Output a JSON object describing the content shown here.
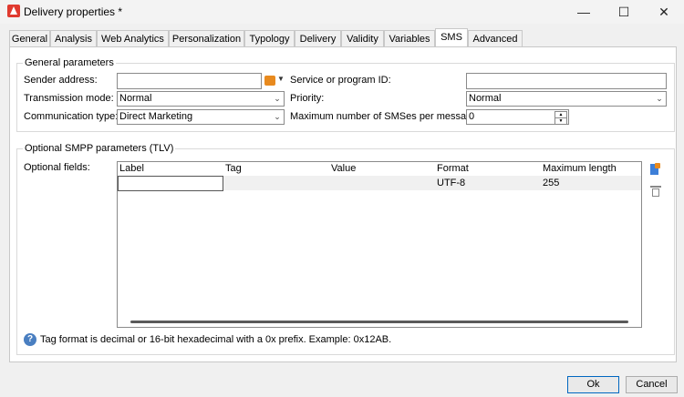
{
  "window": {
    "title": "Delivery properties *"
  },
  "tabs": [
    "General",
    "Analysis",
    "Web Analytics",
    "Personalization",
    "Typology",
    "Delivery",
    "Validity",
    "Variables",
    "SMS",
    "Advanced"
  ],
  "active_tab": "SMS",
  "general_parameters": {
    "title": "General parameters",
    "sender_address_label": "Sender address:",
    "sender_address_value": "",
    "service_id_label": "Service or program ID:",
    "service_id_value": "",
    "transmission_mode_label": "Transmission mode:",
    "transmission_mode_value": "Normal",
    "priority_label": "Priority:",
    "priority_value": "Normal",
    "communication_type_label": "Communication type:",
    "communication_type_value": "Direct Marketing",
    "max_sms_label": "Maximum number of SMSes per message:",
    "max_sms_value": "0"
  },
  "smpp": {
    "title": "Optional SMPP parameters (TLV)",
    "optional_fields_label": "Optional fields:",
    "columns": [
      "Label",
      "Tag",
      "Value",
      "Format",
      "Maximum length"
    ],
    "rows": [
      {
        "label": "",
        "tag": "",
        "value": "",
        "format": "UTF-8",
        "max_length": "255"
      }
    ]
  },
  "help_text": "Tag format is decimal or 16-bit hexadecimal with a 0x prefix. Example: 0x12AB.",
  "buttons": {
    "ok": "Ok",
    "cancel": "Cancel"
  },
  "icons": {
    "add": "add-field-icon",
    "delete": "trash-icon",
    "help": "help-icon",
    "picker": "address-picker-icon"
  },
  "colors": {
    "accent": "#0067c0",
    "app_icon": "#e03a2f"
  }
}
